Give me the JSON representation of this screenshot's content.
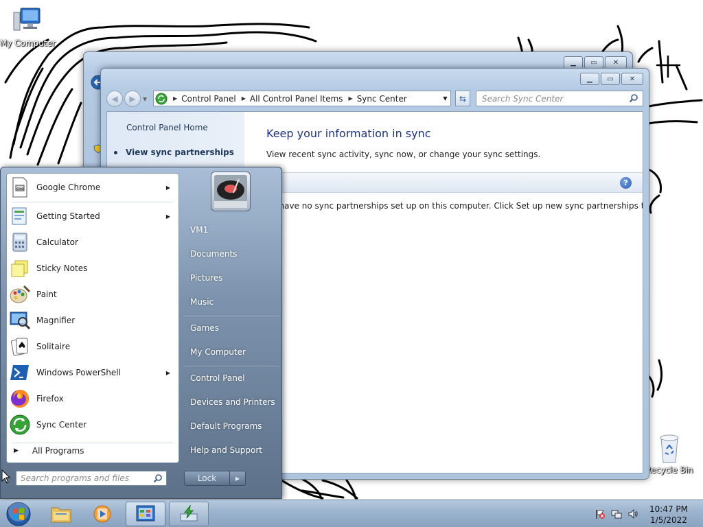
{
  "desktop": {
    "my_computer_label": "My Computer",
    "recycle_bin_label": "Recycle Bin"
  },
  "window": {
    "address": {
      "crumbs": [
        "Control Panel",
        "All Control Panel Items",
        "Sync Center"
      ]
    },
    "search_placeholder": "Search Sync Center",
    "left_pane": {
      "home_link": "Control Panel Home",
      "task_selected": "View sync partnerships"
    },
    "heading": "Keep your information in sync",
    "subheading": "View recent sync activity, sync now, or change your sync settings.",
    "message": "You have no sync partnerships set up on this computer. Click Set up new sync partnerships to get started."
  },
  "start_menu": {
    "programs": [
      {
        "name": "Google Chrome",
        "icon": "chrome-doc-icon",
        "has_submenu": true
      },
      {
        "name": "Getting Started",
        "icon": "getting-started-icon",
        "has_submenu": true
      },
      {
        "name": "Calculator",
        "icon": "calculator-icon",
        "has_submenu": false
      },
      {
        "name": "Sticky Notes",
        "icon": "sticky-notes-icon",
        "has_submenu": false
      },
      {
        "name": "Paint",
        "icon": "paint-icon",
        "has_submenu": false
      },
      {
        "name": "Magnifier",
        "icon": "magnifier-icon",
        "has_submenu": false
      },
      {
        "name": "Solitaire",
        "icon": "solitaire-icon",
        "has_submenu": false
      },
      {
        "name": "Windows PowerShell",
        "icon": "powershell-icon",
        "has_submenu": true
      },
      {
        "name": "Firefox",
        "icon": "firefox-icon",
        "has_submenu": false
      },
      {
        "name": "Sync Center",
        "icon": "sync-center-icon",
        "has_submenu": false
      }
    ],
    "all_programs": "All Programs",
    "search_placeholder": "Search programs and files",
    "right_items": [
      "VM1",
      "Documents",
      "Pictures",
      "Music",
      "Games",
      "My Computer",
      "Control Panel",
      "Devices and Printers",
      "Default Programs",
      "Help and Support"
    ],
    "lock_label": "Lock"
  },
  "taskbar": {
    "time": "10:47 PM",
    "date": "1/5/2022"
  },
  "colors": {
    "heading_blue": "#1e3287",
    "link_navy": "#1e395b",
    "taskbar": "#9bb3cd"
  }
}
